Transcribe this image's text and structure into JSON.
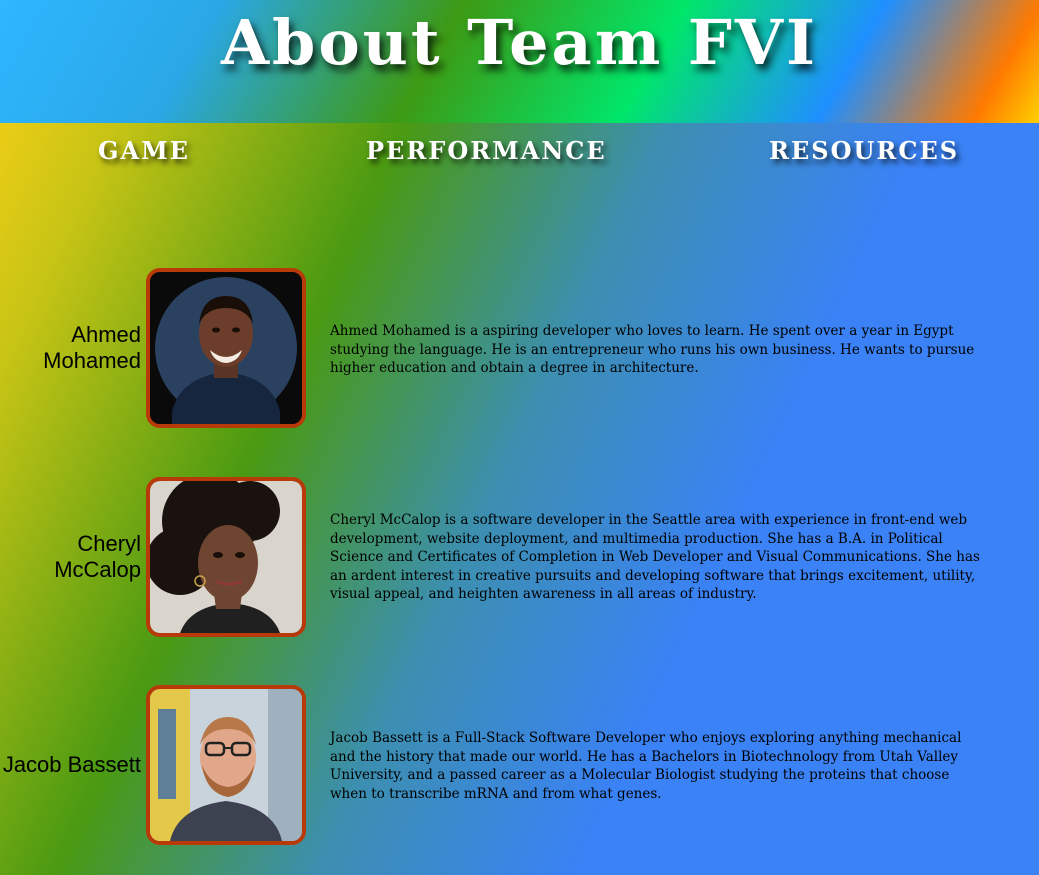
{
  "header": {
    "title": "About Team FVI"
  },
  "nav": {
    "items": [
      {
        "label": "GAME"
      },
      {
        "label": "PERFORMANCE"
      },
      {
        "label": "RESOURCES"
      }
    ]
  },
  "members": [
    {
      "name_line1": "Ahmed",
      "name_line2": "Mohamed",
      "photo_alt": "Ahmed Mohamed",
      "bio": "Ahmed Mohamed is a aspiring developer who loves to learn. He spent over a year in Egypt studying the language. He is an entrepreneur who runs his own business. He wants to pursue higher education and obtain a degree in architecture."
    },
    {
      "name_line1": "Cheryl",
      "name_line2": "McCalop",
      "photo_alt": "Cheryl McCalop",
      "bio": "Cheryl McCalop is a software developer in the Seattle area with experience in front-end web development, website deployment, and multimedia production. She has a B.A. in Political Science and Certificates of Completion in Web Developer and Visual Communications. She has an ardent interest in creative pursuits and developing software that brings excitement, utility, visual appeal, and heighten awareness in all areas of industry."
    },
    {
      "name_line1": "Jacob Bassett",
      "name_line2": "",
      "photo_alt": "Jacob Bassett",
      "bio": "Jacob Bassett is a Full-Stack Software Developer who enjoys exploring anything mechanical and the history that made our world. He has a Bachelors in Biotechnology from Utah Valley University, and a passed career as a Molecular Biologist studying the proteins that choose when to transcribe mRNA and from what genes."
    }
  ],
  "colors": {
    "frame_border": "#b83a08",
    "title_text": "#ffffff",
    "body_text": "#000000"
  }
}
